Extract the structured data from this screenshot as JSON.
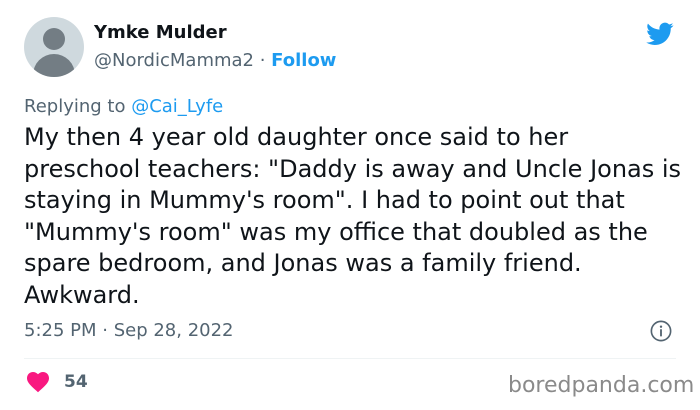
{
  "author": {
    "name": "Ymke Mulder",
    "handle": "@NordicMamma2",
    "separator": " · ",
    "follow_label": "Follow"
  },
  "reply": {
    "prefix": "Replying to ",
    "mention": "@Cai_Lyfe"
  },
  "tweet": {
    "text": "My then 4 year old daughter once said to her preschool teachers: \"Daddy is away and Uncle Jonas is staying in Mummy's room\". I had to point out that \"Mummy's room\" was my office that doubled as the spare bedroom, and Jonas was a family friend. Awkward.",
    "timestamp": "5:25 PM · Sep 28, 2022"
  },
  "engagement": {
    "likes": "54"
  },
  "watermark": "boredpanda.com",
  "colors": {
    "accent": "#1d9bf0",
    "heart": "#f91880",
    "muted": "#536471"
  },
  "icons": {
    "brand": "twitter-bird-icon",
    "info": "info-icon",
    "like": "heart-icon"
  }
}
